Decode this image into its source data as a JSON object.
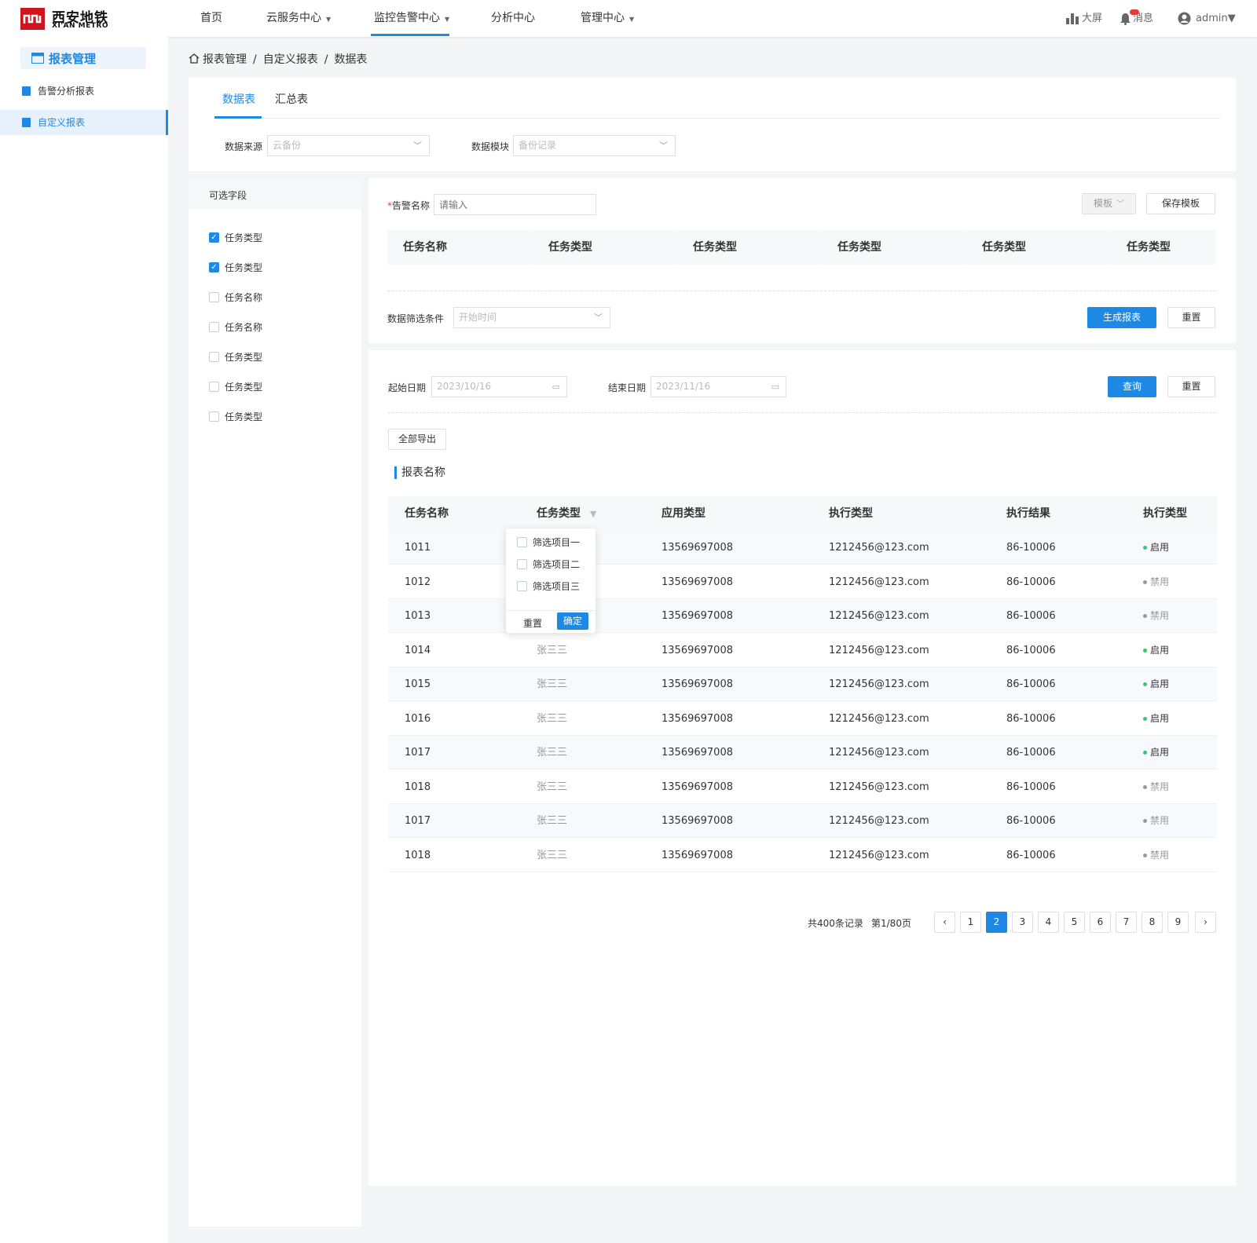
{
  "header": {
    "brand_cn": "西安地铁",
    "brand_en": "XI'AN METRO",
    "nav": [
      "首页",
      "云服务中心",
      "监控告警中心",
      "分析中心",
      "管理中心"
    ],
    "right": {
      "screen": "大屏",
      "messages": "消息",
      "user": "admin"
    }
  },
  "sidebar": {
    "title": "报表管理",
    "items": [
      "告警分析报表",
      "自定义报表"
    ]
  },
  "breadcrumb": [
    "报表管理",
    "自定义报表",
    "数据表"
  ],
  "tabs": [
    "数据表",
    "汇总表"
  ],
  "filters": {
    "source_label": "数据来源",
    "source_value": "云备份",
    "module_label": "数据模块",
    "module_value": "备份记录"
  },
  "fields": {
    "title": "可选字段",
    "items": [
      {
        "label": "任务类型",
        "checked": true
      },
      {
        "label": "任务类型",
        "checked": true
      },
      {
        "label": "任务名称",
        "checked": false
      },
      {
        "label": "任务名称",
        "checked": false
      },
      {
        "label": "任务类型",
        "checked": false
      },
      {
        "label": "任务类型",
        "checked": false
      },
      {
        "label": "任务类型",
        "checked": false
      }
    ]
  },
  "builder": {
    "alarm_label": "告警名称",
    "alarm_placeholder": "请输入",
    "template_btn": "模板",
    "save_template_btn": "保存模板",
    "columns": [
      "任务名称",
      "任务类型",
      "任务类型",
      "任务类型",
      "任务类型",
      "任务类型"
    ],
    "condition_label": "数据筛选条件",
    "condition_placeholder": "开始时间",
    "generate_btn": "生成报表",
    "reset_btn": "重置"
  },
  "query": {
    "start_label": "起始日期",
    "start_value": "2023/10/16",
    "end_label": "结束日期",
    "end_value": "2023/11/16",
    "query_btn": "查询",
    "reset_btn": "重置",
    "export_btn": "全部导出"
  },
  "report": {
    "title": "报表名称",
    "columns": [
      "任务名称",
      "任务类型",
      "应用类型",
      "执行类型",
      "执行结果",
      "执行类型"
    ],
    "rows": [
      {
        "id": "1011",
        "type": "",
        "phone": "13569697008",
        "email": "1212456@123.com",
        "result": "86-10006",
        "status": "启用",
        "on": true
      },
      {
        "id": "1012",
        "type": "",
        "phone": "13569697008",
        "email": "1212456@123.com",
        "result": "86-10006",
        "status": "禁用",
        "on": false
      },
      {
        "id": "1013",
        "type": "",
        "phone": "13569697008",
        "email": "1212456@123.com",
        "result": "86-10006",
        "status": "禁用",
        "on": false
      },
      {
        "id": "1014",
        "type": "张三三",
        "phone": "13569697008",
        "email": "1212456@123.com",
        "result": "86-10006",
        "status": "启用",
        "on": true
      },
      {
        "id": "1015",
        "type": "张三三",
        "phone": "13569697008",
        "email": "1212456@123.com",
        "result": "86-10006",
        "status": "启用",
        "on": true
      },
      {
        "id": "1016",
        "type": "张三三",
        "phone": "13569697008",
        "email": "1212456@123.com",
        "result": "86-10006",
        "status": "启用",
        "on": true
      },
      {
        "id": "1017",
        "type": "张三三",
        "phone": "13569697008",
        "email": "1212456@123.com",
        "result": "86-10006",
        "status": "启用",
        "on": true
      },
      {
        "id": "1018",
        "type": "张三三",
        "phone": "13569697008",
        "email": "1212456@123.com",
        "result": "86-10006",
        "status": "禁用",
        "on": false
      },
      {
        "id": "1017",
        "type": "张三三",
        "phone": "13569697008",
        "email": "1212456@123.com",
        "result": "86-10006",
        "status": "禁用",
        "on": false
      },
      {
        "id": "1018",
        "type": "张三三",
        "phone": "13569697008",
        "email": "1212456@123.com",
        "result": "86-10006",
        "status": "禁用",
        "on": false
      }
    ]
  },
  "filter_popup": {
    "options": [
      "筛选项目一",
      "筛选项目二",
      "筛选项目三"
    ],
    "reset": "重置",
    "confirm": "确定"
  },
  "pagination": {
    "total": "共400条记录",
    "page_info": "第1/80页",
    "pages": [
      "1",
      "2",
      "3",
      "4",
      "5",
      "6",
      "7",
      "8",
      "9"
    ],
    "current": "2"
  },
  "colors": {
    "accent": "#1e88e5",
    "brand": "#d0141e",
    "enabled": "#2ecc71",
    "disabled": "#999999"
  }
}
